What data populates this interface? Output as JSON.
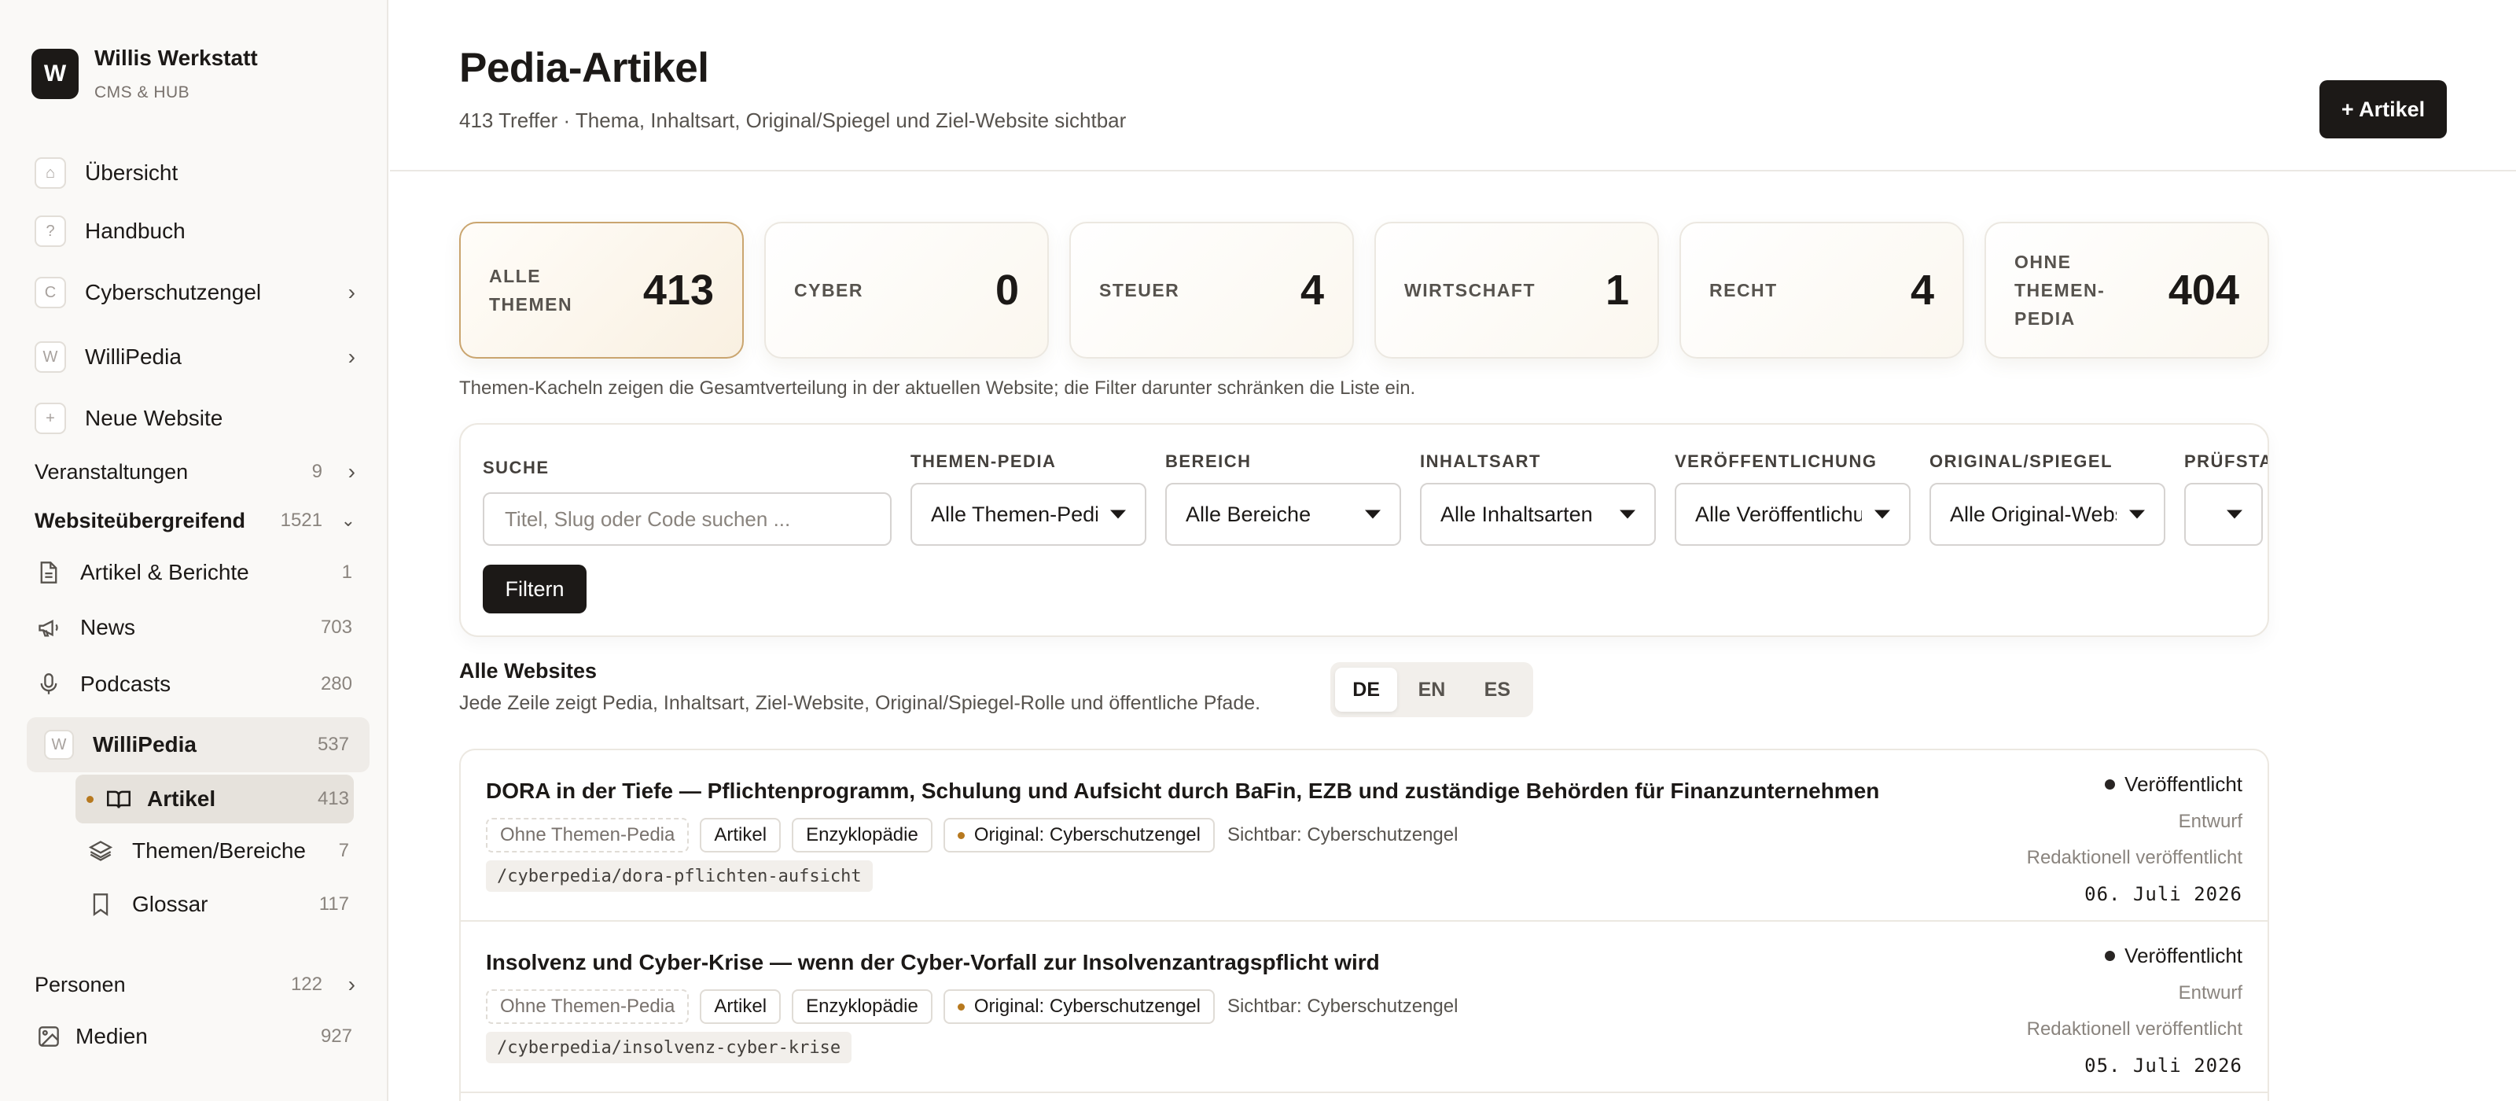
{
  "brand": {
    "logo_letter": "W",
    "name": "Willis Werkstatt",
    "subtitle": "CMS & HUB"
  },
  "sidebar": {
    "top_items": [
      {
        "icon": "home-icon",
        "glyph": "⌂",
        "label": "Übersicht"
      },
      {
        "icon": "help-icon",
        "glyph": "?",
        "label": "Handbuch"
      },
      {
        "icon": "site-c-icon",
        "glyph": "C",
        "label": "Cyberschutzengel",
        "chevron": "›"
      },
      {
        "icon": "site-w-icon",
        "glyph": "W",
        "label": "WilliPedia",
        "chevron": "›"
      },
      {
        "icon": "plus-icon",
        "glyph": "+",
        "label": "Neue Website"
      }
    ],
    "veranstaltungen": {
      "label": "Veranstaltungen",
      "count": "9",
      "chevron": "›"
    },
    "websiteuebergreifend": {
      "label": "Websiteübergreifend",
      "count": "1521",
      "chevron": "⌄"
    },
    "sub_items": [
      {
        "icon": "document-icon",
        "label": "Artikel & Berichte",
        "count": "1"
      },
      {
        "icon": "megaphone-icon",
        "label": "News",
        "count": "703"
      },
      {
        "icon": "microphone-icon",
        "label": "Podcasts",
        "count": "280"
      }
    ],
    "willipedia": {
      "glyph": "W",
      "label": "WilliPedia",
      "count": "537"
    },
    "willipedia_children": [
      {
        "icon": "book-open-icon",
        "label": "Artikel",
        "count": "413",
        "active": true
      },
      {
        "icon": "layers-icon",
        "label": "Themen/Bereiche",
        "count": "7"
      },
      {
        "icon": "bookmark-icon",
        "label": "Glossar",
        "count": "117"
      }
    ],
    "personen": {
      "label": "Personen",
      "count": "122",
      "chevron": "›"
    },
    "medien": {
      "icon": "image-icon",
      "label": "Medien",
      "count": "927"
    }
  },
  "header": {
    "title": "Pedia-Artikel",
    "subtitle": "413 Treffer · Thema, Inhaltsart, Original/Spiegel und Ziel-Website sichtbar",
    "new_button": "+ Artikel"
  },
  "tiles": [
    {
      "label": "ALLE THEMEN",
      "value": "413",
      "active": true
    },
    {
      "label": "CYBER",
      "value": "0"
    },
    {
      "label": "STEUER",
      "value": "4"
    },
    {
      "label": "WIRTSCHAFT",
      "value": "1"
    },
    {
      "label": "RECHT",
      "value": "4"
    },
    {
      "label": "OHNE THEMEN-PEDIA",
      "value": "404"
    }
  ],
  "tiles_note": "Themen-Kacheln zeigen die Gesamtverteilung in der aktuellen Website; die Filter darunter schränken die Liste ein.",
  "filters": {
    "search": {
      "label": "SUCHE",
      "placeholder": "Titel, Slug oder Code suchen ..."
    },
    "selects": [
      {
        "label": "THEMEN-PEDIA",
        "value": "Alle Themen-Pedia"
      },
      {
        "label": "BEREICH",
        "value": "Alle Bereiche"
      },
      {
        "label": "INHALTSART",
        "value": "Alle Inhaltsarten"
      },
      {
        "label": "VERÖFFENTLICHUNG",
        "value": "Alle Veröffentlichungen"
      },
      {
        "label": "ORIGINAL/SPIEGEL",
        "value": "Alle Original-Websites"
      },
      {
        "label": "PRÜFSTAND",
        "value": ""
      }
    ],
    "submit": "Filtern"
  },
  "list": {
    "title": "Alle Websites",
    "subtitle": "Jede Zeile zeigt Pedia, Inhaltsart, Ziel-Website, Original/Spiegel-Rolle und öffentliche Pfade.",
    "languages": [
      {
        "code": "DE",
        "active": true
      },
      {
        "code": "EN"
      },
      {
        "code": "ES"
      }
    ]
  },
  "articles": [
    {
      "title": "DORA in der Tiefe — Pflichtenprogramm, Schulung und Aufsicht durch BaFin, EZB und zuständige Behörden für Finanzunternehmen",
      "tag_pedia": "Ohne Themen-Pedia",
      "tag_type": "Artikel",
      "tag_kind": "Enzyklopädie",
      "tag_origin": "Original: Cyberschutzengel",
      "visible": "Sichtbar: Cyberschutzengel",
      "slug": "/cyberpedia/dora-pflichten-aufsicht",
      "status": "Veröffentlicht",
      "state": "Entwurf",
      "editorial": "Redaktionell veröffentlicht",
      "date": "06. Juli 2026"
    },
    {
      "title": "Insolvenz und Cyber-Krise — wenn der Cyber-Vorfall zur Insolvenzantragspflicht wird",
      "tag_pedia": "Ohne Themen-Pedia",
      "tag_type": "Artikel",
      "tag_kind": "Enzyklopädie",
      "tag_origin": "Original: Cyberschutzengel",
      "visible": "Sichtbar: Cyberschutzengel",
      "slug": "/cyberpedia/insolvenz-cyber-krise",
      "status": "Veröffentlicht",
      "state": "Entwurf",
      "editorial": "Redaktionell veröffentlicht",
      "date": "05. Juli 2026"
    }
  ]
}
